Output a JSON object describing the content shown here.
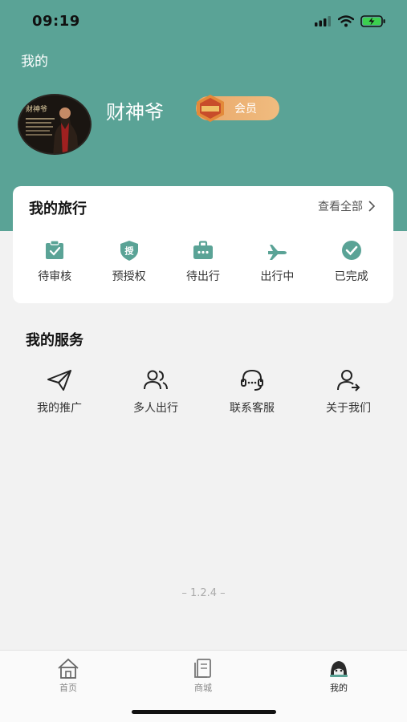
{
  "status_bar": {
    "time": "09:19"
  },
  "header": {
    "title": "我的"
  },
  "profile": {
    "username": "财神爷",
    "vip_label": "会员",
    "avatar_caption": "财神爷"
  },
  "trip": {
    "title": "我的旅行",
    "view_all": "查看全部",
    "items": [
      {
        "label": "待审核",
        "icon": "clipboard-check-icon"
      },
      {
        "label": "预授权",
        "icon": "shield-authorize-icon"
      },
      {
        "label": "待出行",
        "icon": "briefcase-icon"
      },
      {
        "label": "出行中",
        "icon": "airplane-icon"
      },
      {
        "label": "已完成",
        "icon": "check-circle-icon"
      }
    ]
  },
  "services": {
    "title": "我的服务",
    "items": [
      {
        "label": "我的推广",
        "icon": "paper-plane-icon"
      },
      {
        "label": "多人出行",
        "icon": "group-users-icon"
      },
      {
        "label": "联系客服",
        "icon": "headset-icon"
      },
      {
        "label": "关于我们",
        "icon": "user-arrow-icon"
      }
    ]
  },
  "version": "– 1.2.4 –",
  "tabbar": {
    "items": [
      {
        "label": "首页",
        "icon": "home-icon"
      },
      {
        "label": "商城",
        "icon": "shop-icon"
      },
      {
        "label": "我的",
        "icon": "profile-icon"
      }
    ]
  },
  "colors": {
    "accent": "#5aa396",
    "vip": "#e9a86b"
  }
}
